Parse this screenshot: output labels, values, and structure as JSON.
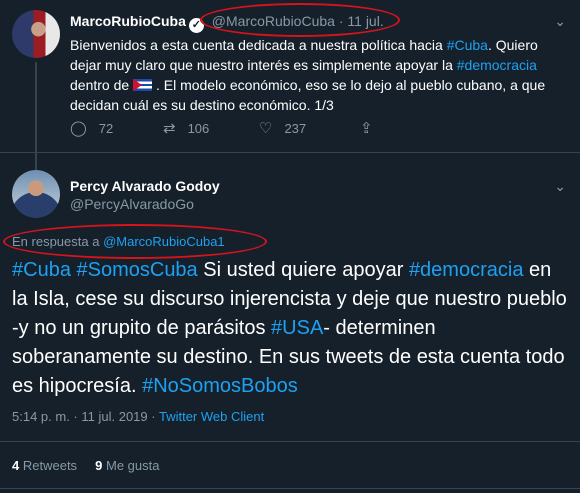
{
  "tweet1": {
    "name": "MarcoRubioCuba",
    "handle": "@MarcoRubioCuba",
    "time": "11 jul.",
    "text_a": "Bienvenidos a esta cuenta dedicada a nuestra política hacia ",
    "hashtag_cuba": "#Cuba",
    "text_b": ". Quiero dejar muy claro que nuestro interés es simplemente apoyar la ",
    "hashtag_democracia": "#democracia",
    "text_c": " dentro de ",
    "text_d": " . El modelo económico, eso se lo dejo al pueblo cubano, a que decidan cuál es su destino económico. 1/3",
    "replies": "72",
    "retweets": "106",
    "likes": "237"
  },
  "tweet2": {
    "name": "Percy Alvarado Godoy",
    "handle": "@PercyAlvaradoGo",
    "reply_prefix": "En respuesta a ",
    "reply_to": "@MarcoRubioCuba1",
    "h1": "#Cuba",
    "h2": "#SomosCuba",
    "t1": " Si usted quiere apoyar ",
    "h3": "#democracia",
    "t2": " en la Isla, cese su discurso injerencista y deje que nuestro pueblo -y no un grupito de parásitos ",
    "h4": "#USA",
    "t3": "- determinen soberanamente su destino. En sus tweets de esta cuenta todo es hipocresía. ",
    "h5": "#NoSomosBobos",
    "time": "5:14 p. m.",
    "date": "11 jul. 2019",
    "client": "Twitter Web Client",
    "retweet_count": "4",
    "retweet_label": "Retweets",
    "like_count": "9",
    "like_label": "Me gusta"
  },
  "colors": {
    "background": "#15202b",
    "link": "#1da1f2",
    "muted": "#8899a6",
    "annotation": "#d5141b"
  }
}
